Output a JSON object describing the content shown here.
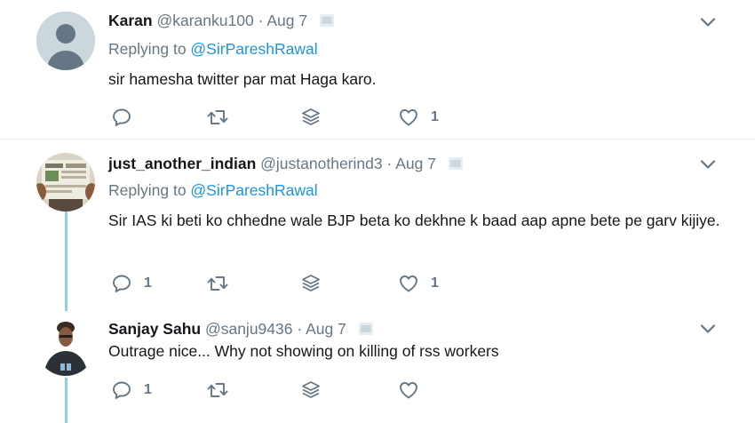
{
  "tweets": [
    {
      "name": "Karan",
      "handle": "@karanku100",
      "dot": "·",
      "date": "Aug 7",
      "replying_prefix": "Replying to ",
      "replying_to": "@SirPareshRawal",
      "text": "sir hamesha twitter par mat Haga karo.",
      "reply_count": "",
      "retweet_count": "",
      "like_count": "1",
      "avatar": "default-profile-avatar"
    },
    {
      "name": "just_another_indian",
      "handle": "@justanotherind3",
      "dot": "·",
      "date": "Aug 7",
      "replying_prefix": "Replying to ",
      "replying_to": "@SirPareshRawal",
      "text": "Sir IAS ki beti ko chhedne wale BJP beta  ko dekhne k baad aap apne bete pe garv kijiye.",
      "reply_count": "1",
      "retweet_count": "",
      "like_count": "1",
      "avatar": "newspaper-photo-avatar"
    },
    {
      "name": "Sanjay Sahu",
      "handle": "@sanju9436",
      "dot": "·",
      "date": "Aug 7",
      "text": "Outrage nice... Why not showing on killing of rss workers",
      "reply_count": "1",
      "retweet_count": "",
      "like_count": "",
      "avatar": "person-photo-avatar"
    }
  ],
  "icons": {
    "reply": "reply-icon",
    "retweet": "retweet-icon",
    "dm": "direct-message-icon",
    "like": "heart-icon",
    "more": "chevron-down-icon",
    "date": "card-icon"
  },
  "colors": {
    "link": "#1b95e0",
    "secondary_text": "#657786",
    "thread_line": "#8ed0e6",
    "divider": "#e6ecf0"
  }
}
